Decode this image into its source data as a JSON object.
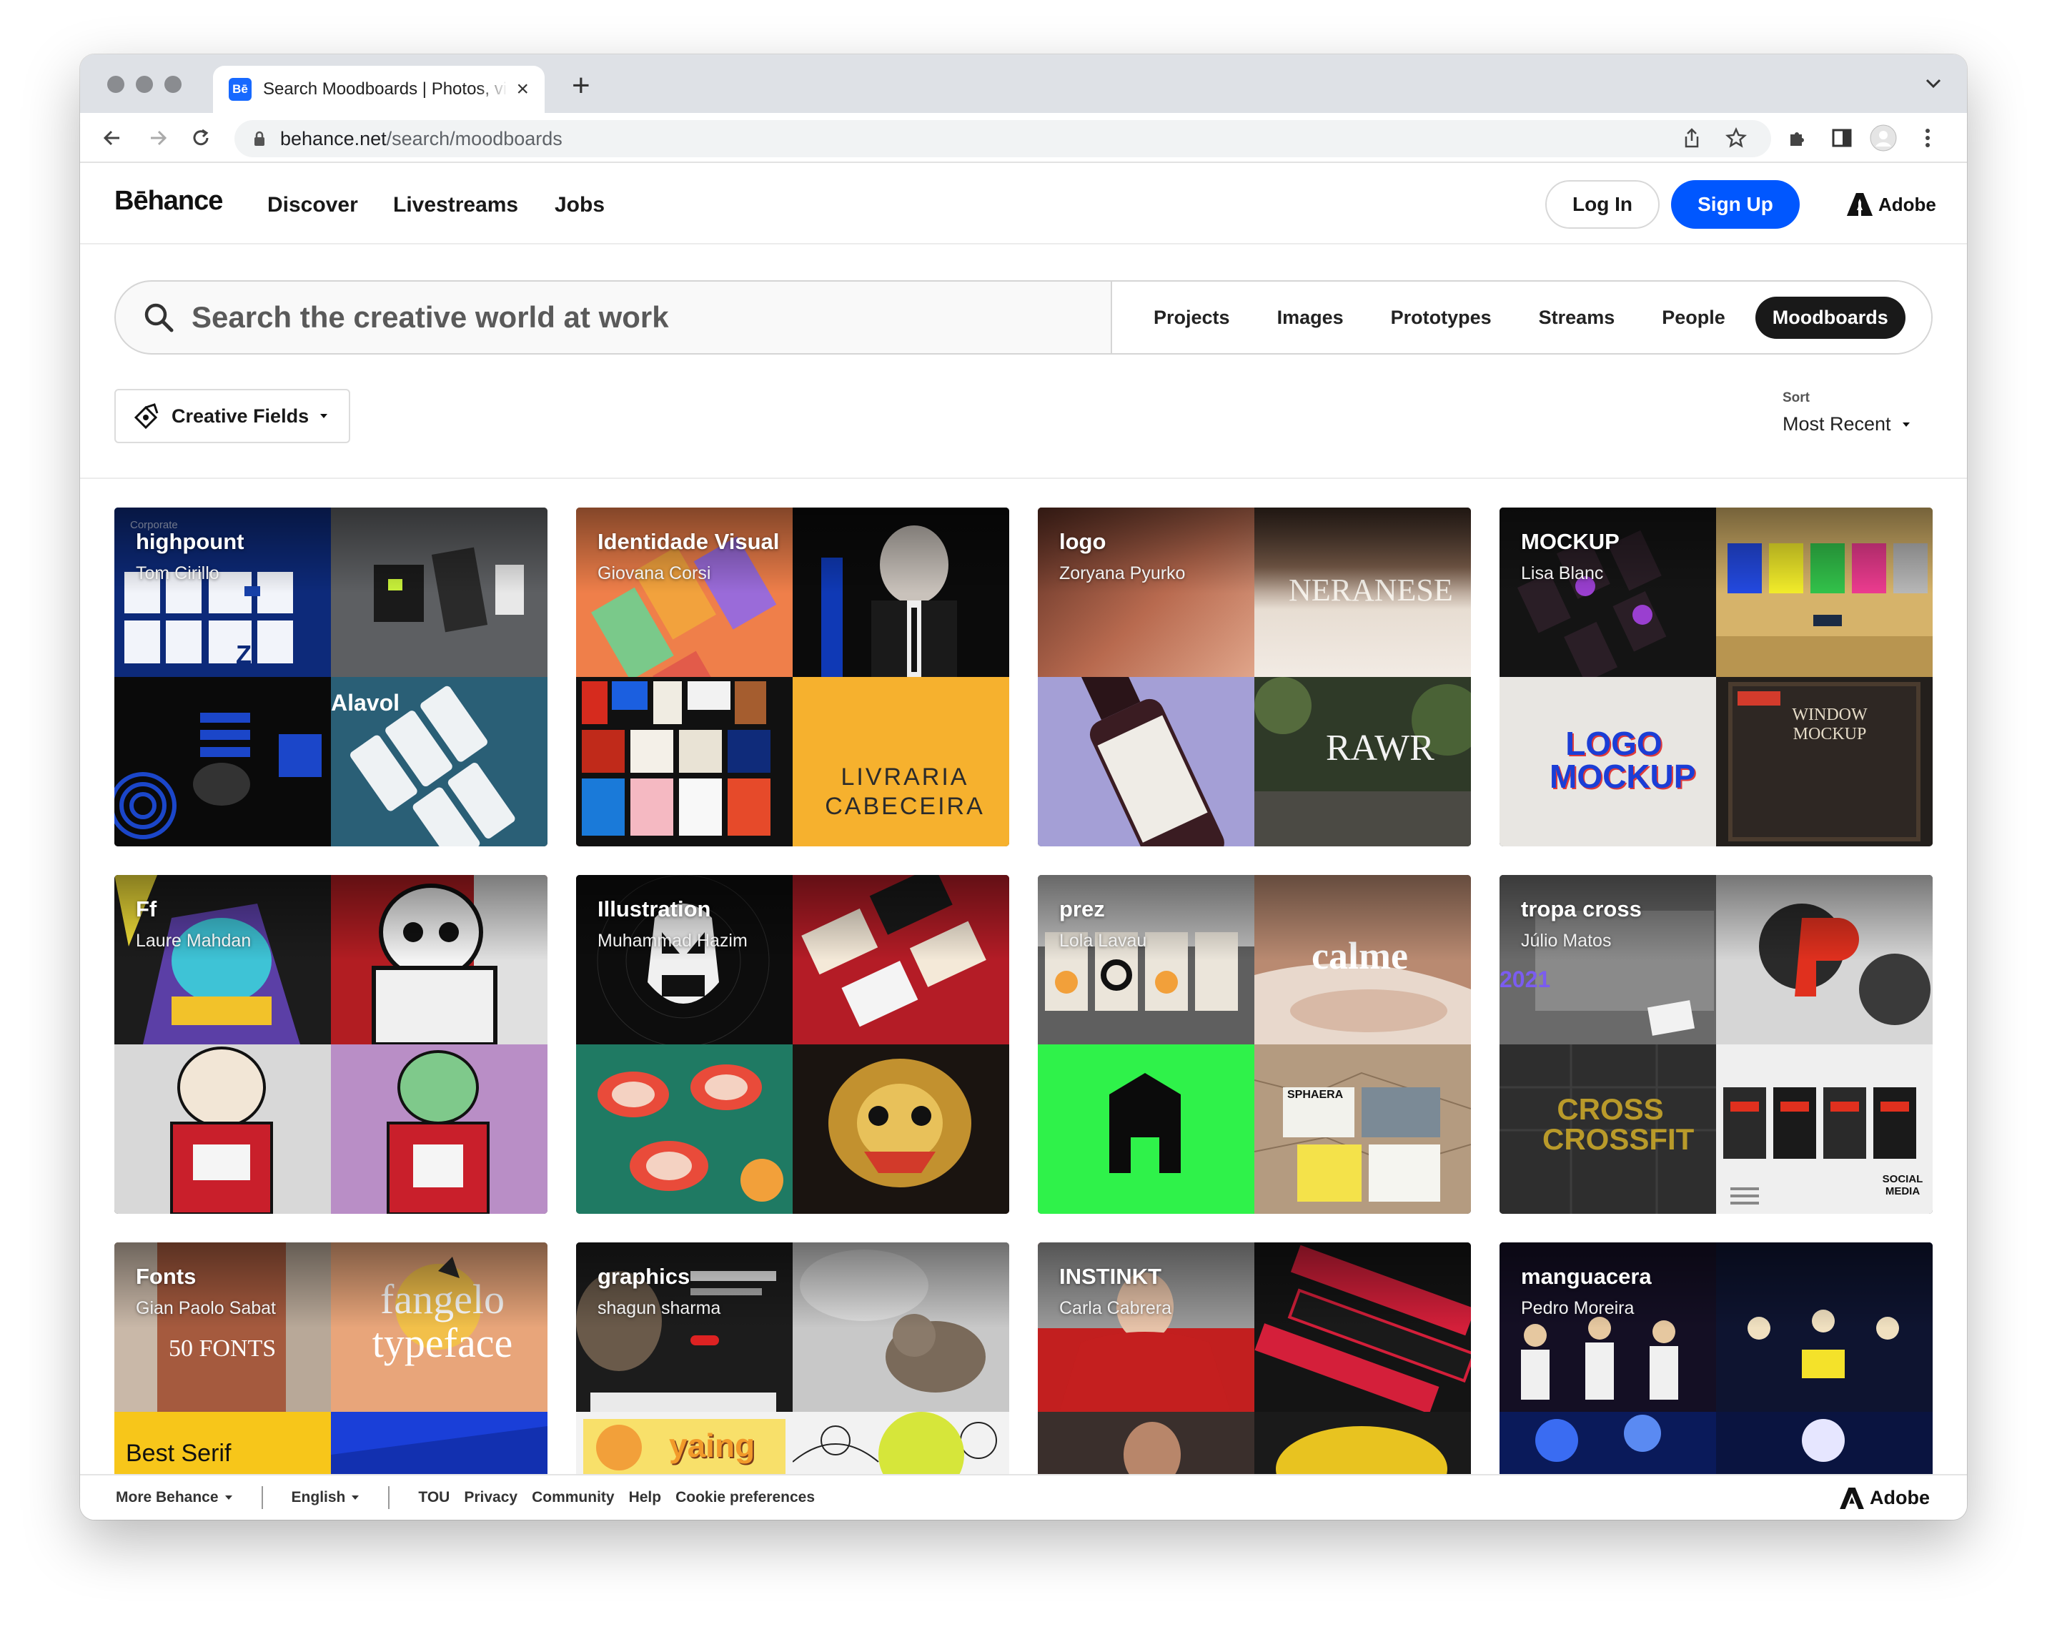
{
  "browser": {
    "tab_title": "Search Moodboards | Photos, videos, logos, illustrations",
    "tab_favicon": "Bē",
    "url_host": "behance.net",
    "url_path": "/search/moodboards"
  },
  "header": {
    "logo": "Bēhance",
    "nav": [
      "Discover",
      "Livestreams",
      "Jobs"
    ],
    "login_label": "Log In",
    "signup_label": "Sign Up",
    "adobe_label": "Adobe"
  },
  "search": {
    "placeholder": "Search the creative world at work",
    "tabs": [
      "Projects",
      "Images",
      "Prototypes",
      "Streams",
      "People",
      "Moodboards"
    ],
    "active_tab": "Moodboards"
  },
  "filters": {
    "creative_fields_label": "Creative Fields",
    "sort_label": "Sort",
    "sort_value": "Most Recent"
  },
  "moodboards": [
    {
      "title": "highpount",
      "owner": "Tom Cirillo",
      "tile_texts": [
        "Corporate",
        "",
        "Alavol",
        ""
      ],
      "colors": [
        "#0d2a7a",
        "#5d5f62",
        "#0a0a0a",
        "#2a5f76"
      ]
    },
    {
      "title": "Identidade Visual",
      "owner": "Giovana Corsi",
      "tile_texts": [
        "",
        "",
        "",
        "LIVRARIA CABECEIRA"
      ],
      "colors": [
        "#ef7f4a",
        "#0b0b0b",
        "#b32519",
        "#f6b12e"
      ]
    },
    {
      "title": "logo",
      "owner": "Zoryana Pyurko",
      "tile_texts": [
        "",
        "NERANESE",
        "",
        "RAWR"
      ],
      "colors": [
        "#8a4a37",
        "#d8cbbf",
        "#a49fd6",
        "#3e4a33"
      ]
    },
    {
      "title": "MOCKUP",
      "owner": "Lisa Blanc",
      "tile_texts": [
        "",
        "",
        "LOGO MOCKUP",
        "WINDOW MOCKUP"
      ],
      "colors": [
        "#141414",
        "#c9a557",
        "#e8e6e2",
        "#231f1c"
      ]
    },
    {
      "title": "Ff",
      "owner": "Laure Mahdan",
      "tile_texts": [
        "",
        "",
        "",
        ""
      ],
      "colors": [
        "#2d4fa7",
        "#b21d22",
        "#d8d8d8",
        "#b98ec6"
      ]
    },
    {
      "title": "Illustration",
      "owner": "Muhammad Hazim",
      "tile_texts": [
        "",
        "",
        "",
        ""
      ],
      "colors": [
        "#0d0d0d",
        "#b41c26",
        "#1f7a63",
        "#8a2d20"
      ]
    },
    {
      "title": "prez",
      "owner": "Lola Lavau",
      "tile_texts": [
        "",
        "calme",
        "",
        "SPHAERA"
      ],
      "colors": [
        "#7d7d7d",
        "#b98a71",
        "#2ff24a",
        "#b49b80"
      ]
    },
    {
      "title": "tropa cross",
      "owner": "Júlio Matos",
      "tile_texts": [
        "2021",
        "",
        "CROSS CROSSFIT",
        "SOCIAL MEDIA"
      ],
      "colors": [
        "#5d5d5d",
        "#1a1a1a",
        "#2a2a2a",
        "#efefef"
      ]
    },
    {
      "title": "Fonts",
      "owner": "Gian Paolo Sabat",
      "tile_texts": [
        "50 FONTS",
        "fangelo typeface",
        "Best Serif",
        ""
      ],
      "colors": [
        "#8c4a35",
        "#e8a57a",
        "#f7c61a",
        "#1a3fd8"
      ]
    },
    {
      "title": "graphics",
      "owner": "shagun sharma",
      "tile_texts": [
        "",
        "",
        "yaing",
        ""
      ],
      "colors": [
        "#242424",
        "#9c9c9c",
        "#f4d43a",
        "#f2f2f2"
      ]
    },
    {
      "title": "INSTINKT",
      "owner": "Carla Cabrera",
      "tile_texts": [
        "",
        "",
        "",
        ""
      ],
      "colors": [
        "#c21f1f",
        "#141414",
        "#3a2f2c",
        "#e8c320"
      ]
    },
    {
      "title": "manguacera",
      "owner": "Pedro Moreira",
      "tile_texts": [
        "",
        "",
        "",
        ""
      ],
      "colors": [
        "#2a1f3a",
        "#1f2b57",
        "#1842c9",
        "#0f1f6b"
      ]
    }
  ],
  "footer": {
    "more_label": "More Behance",
    "language": "English",
    "links": [
      "TOU",
      "Privacy",
      "Community",
      "Help",
      "Cookie preferences"
    ],
    "adobe_label": "Adobe"
  }
}
